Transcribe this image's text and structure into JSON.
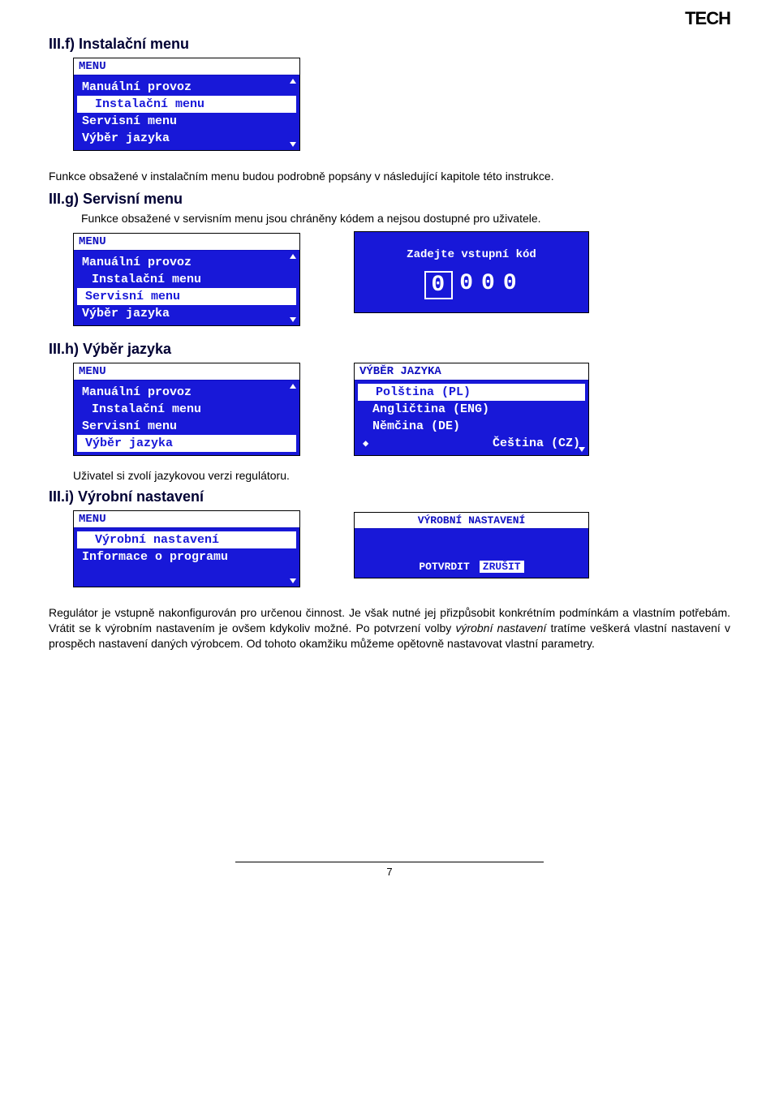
{
  "brand": "TECH",
  "sections": {
    "f": {
      "heading": "III.f) Instalační menu",
      "paragraph": "Funkce obsažené v instalačním menu budou podrobně popsány v následující kapitole této instrukce."
    },
    "g": {
      "heading": "III.g) Servisní menu",
      "paragraph": "Funkce obsažené v servisním menu jsou chráněny kódem a nejsou dostupné pro uživatele."
    },
    "h": {
      "heading": "III.h) Výběr jazyka",
      "note": "Uživatel si zvolí jazykovou verzi regulátoru."
    },
    "i": {
      "heading": "III.i) Výrobní nastavení",
      "paragraph": "Regulátor je vstupně nakonfigurován pro určenou činnost. Je však nutné jej přizpůsobit konkrétním podmínkám a vlastním potřebám. Vrátit se k výrobním nastavením je ovšem kdykoliv možné. Po potvrzení volby výrobní nastavení tratíme veškerá vlastní nastavení v prospěch nastavení daných výrobcem. Od tohoto okamžiku můžeme opětovně nastavovat vlastní parametry.",
      "italic_phrase": "výrobní nastavení"
    }
  },
  "menu_screen": {
    "title": "MENU",
    "items": [
      "Manuální provoz",
      "Instalační menu",
      "Servisní menu",
      "Výběr jazyka"
    ]
  },
  "code_screen": {
    "label": "Zadejte vstupní kód",
    "digits": [
      "0",
      "0",
      "0",
      "0"
    ]
  },
  "lang_screen": {
    "title": "VÝBĚR JAZYKA",
    "items": [
      "Polština (PL)",
      "Angličtina (ENG)",
      "Němčina (DE)",
      "Čeština (CZ)"
    ],
    "selected_index": 0,
    "bullet_index": 3
  },
  "factory_menu": {
    "title": "MENU",
    "items": [
      "Výrobní nastavení",
      "Informace o programu"
    ],
    "selected_index": 0
  },
  "confirm_screen": {
    "title": "VÝROBNÍ NASTAVENÍ",
    "confirm": "POTVRDIT",
    "cancel": "ZRUŠIT"
  },
  "page_number": "7"
}
